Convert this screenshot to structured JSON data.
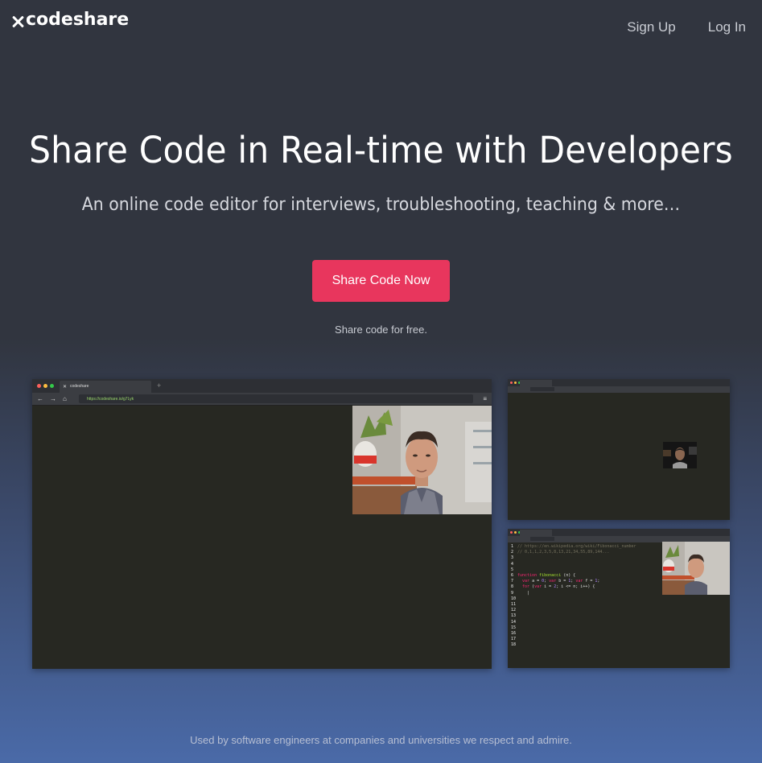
{
  "nav": {
    "logo_text": "codeshare",
    "signup_label": "Sign Up",
    "login_label": "Log In"
  },
  "hero": {
    "title": "Share Code in Real-time with Developers",
    "subtitle": "An online code editor for interviews, troubleshooting, teaching & more…",
    "cta_label": "Share Code Now",
    "free_note": "Share code for free."
  },
  "mock_main": {
    "tab_title": "codeshare",
    "url": "https://codeshare.io/g7Lyk"
  },
  "mock_side": {
    "code_lines": [
      {
        "n": "1",
        "html": "<span class=\"c-cmt\">// https://en.wikipedia.org/wiki/Fibonacci_number</span>"
      },
      {
        "n": "2",
        "html": "<span class=\"c-cmt\">// 0,1,1,2,3,5,8,13,21,34,55,89,144...</span>"
      },
      {
        "n": "3",
        "html": ""
      },
      {
        "n": "4",
        "html": ""
      },
      {
        "n": "5",
        "html": ""
      },
      {
        "n": "6",
        "html": "<span class=\"c-kw\">function</span> <span class=\"c-fn\">fibonacci</span> (n) {"
      },
      {
        "n": "7",
        "html": "&nbsp;&nbsp;<span class=\"c-kw\">var</span> a = <span class=\"c-num\">0</span>; <span class=\"c-kw\">var</span> b = <span class=\"c-num\">1</span>; <span class=\"c-kw\">var</span> f = <span class=\"c-num\">1</span>;"
      },
      {
        "n": "8",
        "html": "&nbsp;&nbsp;<span class=\"c-kw\">for</span> (<span class=\"c-kw\">var</span> i = <span class=\"c-num\">2</span>; i &lt;= n; i++) {"
      },
      {
        "n": "9",
        "html": "&nbsp;&nbsp;&nbsp;&nbsp;|"
      },
      {
        "n": "10",
        "html": ""
      },
      {
        "n": "11",
        "html": ""
      },
      {
        "n": "12",
        "html": ""
      },
      {
        "n": "13",
        "html": ""
      },
      {
        "n": "14",
        "html": ""
      },
      {
        "n": "15",
        "html": ""
      },
      {
        "n": "16",
        "html": ""
      },
      {
        "n": "17",
        "html": ""
      },
      {
        "n": "18",
        "html": ""
      }
    ]
  },
  "footer": {
    "text": "Used by software engineers at companies and universities we respect and admire."
  },
  "colors": {
    "cta": "#e8365d",
    "bg_top": "#31353f",
    "bg_bottom": "#4a6aa8",
    "editor_bg": "#272822"
  }
}
